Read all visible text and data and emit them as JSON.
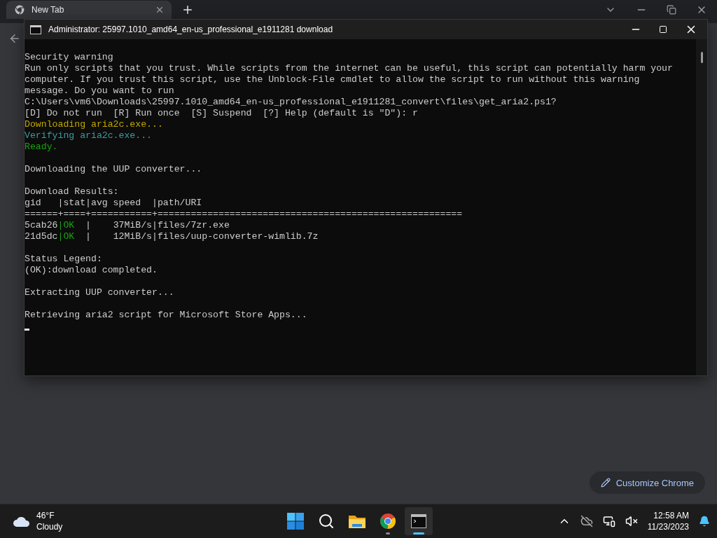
{
  "browser": {
    "tabs": [
      {
        "title": "New Tab",
        "selected": true
      }
    ],
    "customize_button": "Customize Chrome"
  },
  "terminal": {
    "title": "Administrator:  25997.1010_amd64_en-us_professional_e1911281 download",
    "blocks": [
      {
        "lines": [
          {
            "segments": [
              {
                "text": "Security warning",
                "color": "#cccccc"
              }
            ]
          },
          {
            "segments": [
              {
                "text": "Run only scripts that you trust. While scripts from the internet can be useful, this script can potentially harm your",
                "color": "#cccccc"
              }
            ]
          },
          {
            "segments": [
              {
                "text": "computer. If you trust this script, use the Unblock-File cmdlet to allow the script to run without this warning",
                "color": "#cccccc"
              }
            ]
          },
          {
            "segments": [
              {
                "text": "message. Do you want to run",
                "color": "#cccccc"
              }
            ]
          },
          {
            "segments": [
              {
                "text": "C:\\Users\\vm6\\Downloads\\25997.1010_amd64_en-us_professional_e1911281_convert\\files\\get_aria2.ps1?",
                "color": "#cccccc"
              }
            ]
          },
          {
            "segments": [
              {
                "text": "[D] Do not run  [R] Run once  [S] Suspend  [?] Help (default is \"D\"): r",
                "color": "#cccccc"
              }
            ]
          },
          {
            "segments": [
              {
                "text": "Downloading aria2c.exe...",
                "color": "#c1a800"
              }
            ]
          },
          {
            "segments": [
              {
                "text": "Verifying aria2c.exe...",
                "color": "#3a9ca0"
              }
            ]
          },
          {
            "segments": [
              {
                "text": "Ready.",
                "color": "#16a60e"
              }
            ]
          }
        ]
      },
      {
        "lines": [
          {
            "segments": [
              {
                "text": "Downloading the UUP converter...",
                "color": "#cccccc"
              }
            ]
          }
        ]
      },
      {
        "lines": [
          {
            "segments": [
              {
                "text": "Download Results:",
                "color": "#cccccc"
              }
            ]
          },
          {
            "segments": [
              {
                "text": "gid   |stat|avg speed  |path/URI",
                "color": "#cccccc"
              }
            ]
          },
          {
            "segments": [
              {
                "text": "======+====+===========+=======================================================",
                "color": "#cccccc"
              }
            ]
          },
          {
            "segments": [
              {
                "text": "5cab26",
                "color": "#cccccc"
              },
              {
                "text": "|OK",
                "color": "#16a60e"
              },
              {
                "text": "  |    37MiB/s|files/7zr.exe",
                "color": "#cccccc"
              }
            ]
          },
          {
            "segments": [
              {
                "text": "21d5dc",
                "color": "#cccccc"
              },
              {
                "text": "|OK",
                "color": "#16a60e"
              },
              {
                "text": "  |    12MiB/s|files/uup-converter-wimlib.7z",
                "color": "#cccccc"
              }
            ]
          }
        ]
      },
      {
        "lines": [
          {
            "segments": [
              {
                "text": "Status Legend:",
                "color": "#cccccc"
              }
            ]
          },
          {
            "segments": [
              {
                "text": "(OK):download completed.",
                "color": "#cccccc"
              }
            ]
          }
        ]
      },
      {
        "lines": [
          {
            "segments": [
              {
                "text": "Extracting UUP converter...",
                "color": "#cccccc"
              }
            ]
          }
        ]
      },
      {
        "lines": [
          {
            "segments": [
              {
                "text": "Retrieving aria2 script for Microsoft Store Apps...",
                "color": "#cccccc"
              }
            ]
          }
        ]
      }
    ]
  },
  "taskbar": {
    "weather": {
      "temperature": "46°F",
      "condition": "Cloudy"
    },
    "apps": [
      {
        "kind": "start",
        "running": false,
        "selected": false
      },
      {
        "kind": "search",
        "running": false,
        "selected": false
      },
      {
        "kind": "files",
        "running": false,
        "selected": false
      },
      {
        "kind": "browser",
        "running": true,
        "selected": false
      },
      {
        "kind": "terminal",
        "running": true,
        "selected": true
      }
    ],
    "clock": {
      "time": "12:58 AM",
      "date": "11/23/2023"
    }
  }
}
